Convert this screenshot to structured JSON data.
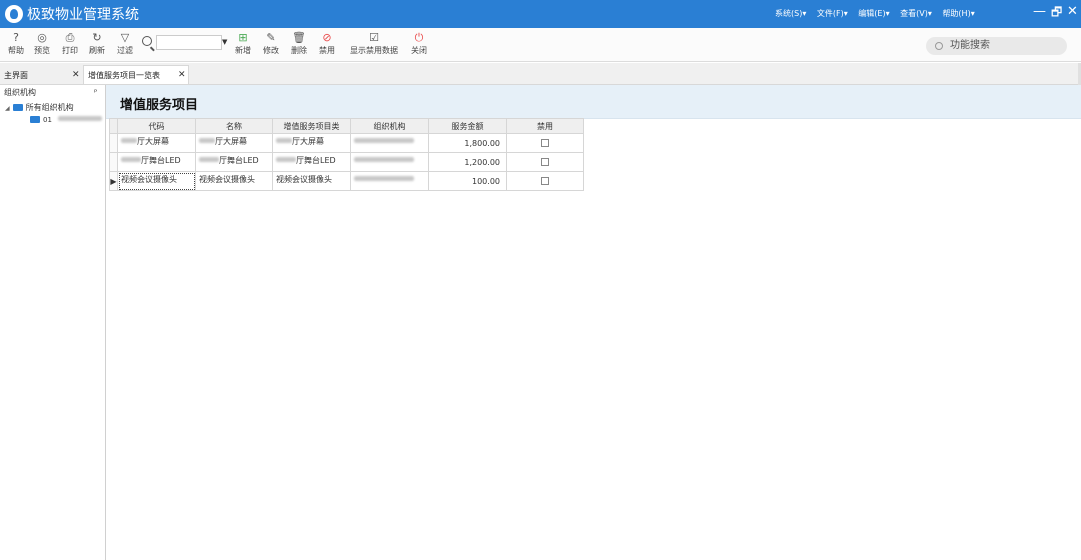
{
  "app": {
    "title": "极致物业管理系统",
    "menus": [
      "系统(S)▾",
      "文件(F)▾",
      "编辑(E)▾",
      "查看(V)▾",
      "帮助(H)▾"
    ],
    "window_controls": [
      "—",
      "🗗",
      "✕"
    ]
  },
  "toolbar": {
    "left_buttons": [
      {
        "label": "帮助",
        "icon": "help-icon",
        "glyph": "?"
      },
      {
        "label": "预览",
        "icon": "eye-icon",
        "glyph": "◎"
      },
      {
        "label": "打印",
        "icon": "printer-icon",
        "glyph": "⎙"
      },
      {
        "label": "刷新",
        "icon": "refresh-icon",
        "glyph": "↻"
      },
      {
        "label": "过滤",
        "icon": "filter-icon",
        "glyph": "▽"
      }
    ],
    "filter_value": "",
    "right_buttons": [
      {
        "label": "新增",
        "icon": "add-icon",
        "glyph": "⊞",
        "color": "green"
      },
      {
        "label": "修改",
        "icon": "edit-icon",
        "glyph": "✎",
        "color": ""
      },
      {
        "label": "删除",
        "icon": "trash-icon",
        "glyph": "🗑",
        "color": ""
      },
      {
        "label": "禁用",
        "icon": "ban-icon",
        "glyph": "⊘",
        "color": "red"
      },
      {
        "label": "显示禁用数据",
        "icon": "show-disabled-icon",
        "glyph": "☑",
        "color": ""
      },
      {
        "label": "关闭",
        "icon": "power-icon",
        "glyph": "⏻",
        "color": "red"
      }
    ],
    "function_search": "功能搜索"
  },
  "tabs": [
    {
      "label": "主界面",
      "close": "✕"
    },
    {
      "label": "增值服务项目一览表",
      "close": "✕"
    }
  ],
  "left_pane": {
    "title": "组织机构",
    "pin": "ᴾ",
    "tree_root": "所有组织机构",
    "tree_child": "01"
  },
  "main": {
    "title": "增值服务项目",
    "columns": [
      "代码",
      "名称",
      "增值服务项目类",
      "组织机构",
      "服务金额",
      "禁用"
    ],
    "rows": [
      {
        "code": "厅大屏幕",
        "name": "厅大屏幕",
        "category": "厅大屏幕",
        "amount": "1,800.00"
      },
      {
        "code": "厅舞台LED",
        "name": "厅舞台LED",
        "category": "厅舞台LED",
        "amount": "1,200.00"
      },
      {
        "code": "视频会议摄像头",
        "name": "视频会议摄像头",
        "category": "视频会议摄像头",
        "amount": "100.00"
      }
    ]
  },
  "colors": {
    "titlebar": "#2a7fd4",
    "page_header": "#e6f0f8",
    "danger": "#e94a4a",
    "success": "#4caa55"
  }
}
